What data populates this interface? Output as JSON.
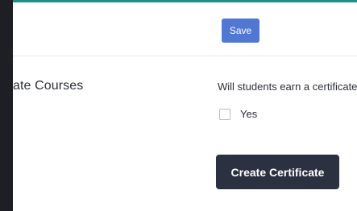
{
  "header": {
    "save_label": "Save"
  },
  "main": {
    "heading": "ate Courses",
    "question": "Will students earn a certificate",
    "option_yes": "Yes",
    "create_certificate_label": "Create Certificate"
  },
  "colors": {
    "accent_teal": "#1f8f88",
    "left_rail": "#1d1f24",
    "save_button": "#4f77d3",
    "create_button": "#2c3141"
  }
}
